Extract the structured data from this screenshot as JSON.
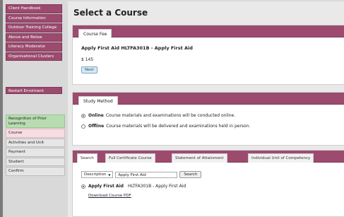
{
  "sidebar": {
    "nav_items": [
      {
        "label": "Client Handbook"
      },
      {
        "label": "Course Information"
      },
      {
        "label": "Outdoor Training College"
      },
      {
        "label": "Above and Below"
      },
      {
        "label": "Literacy Moderator"
      },
      {
        "label": "Organisational Clusters"
      }
    ],
    "restart_label": "Restart Enrolment",
    "steps": [
      {
        "label": "Recognition of Prior Learning",
        "state": "done"
      },
      {
        "label": "Course",
        "state": "active"
      },
      {
        "label": "Activities and Unit",
        "state": "todo"
      },
      {
        "label": "Payment",
        "state": "todo"
      },
      {
        "label": "Student",
        "state": "todo"
      },
      {
        "label": "Confirm",
        "state": "todo"
      }
    ]
  },
  "page": {
    "title": "Select a Course"
  },
  "fee": {
    "tab_label": "Course Fee",
    "course_name": "Apply First Aid HLTFA301B - Apply First Aid",
    "amount": "$ 145",
    "next_label": "Next"
  },
  "method": {
    "tab_label": "Study Method",
    "options": [
      {
        "title": "Online",
        "desc": "Course materials and examinations will be conducted online.",
        "checked": true
      },
      {
        "title": "Offline",
        "desc": "Course materials will be delivered and examinations held in person.",
        "checked": false
      }
    ]
  },
  "search": {
    "tabs": [
      "Search",
      "Full Certificate Course",
      "Statement of Attainment",
      "Individual Unit of Competency"
    ],
    "filter_value": "Description",
    "query": "Apply First Aid",
    "button_label": "Search",
    "result_title": "Apply First Aid",
    "result_desc": "HLTFA301B - Apply First Aid",
    "pdf_link": "Download Course PDF"
  },
  "colors": {
    "accent": "#9c4b6f",
    "step_done": "#b7dcb0",
    "step_active": "#f6dde3"
  }
}
